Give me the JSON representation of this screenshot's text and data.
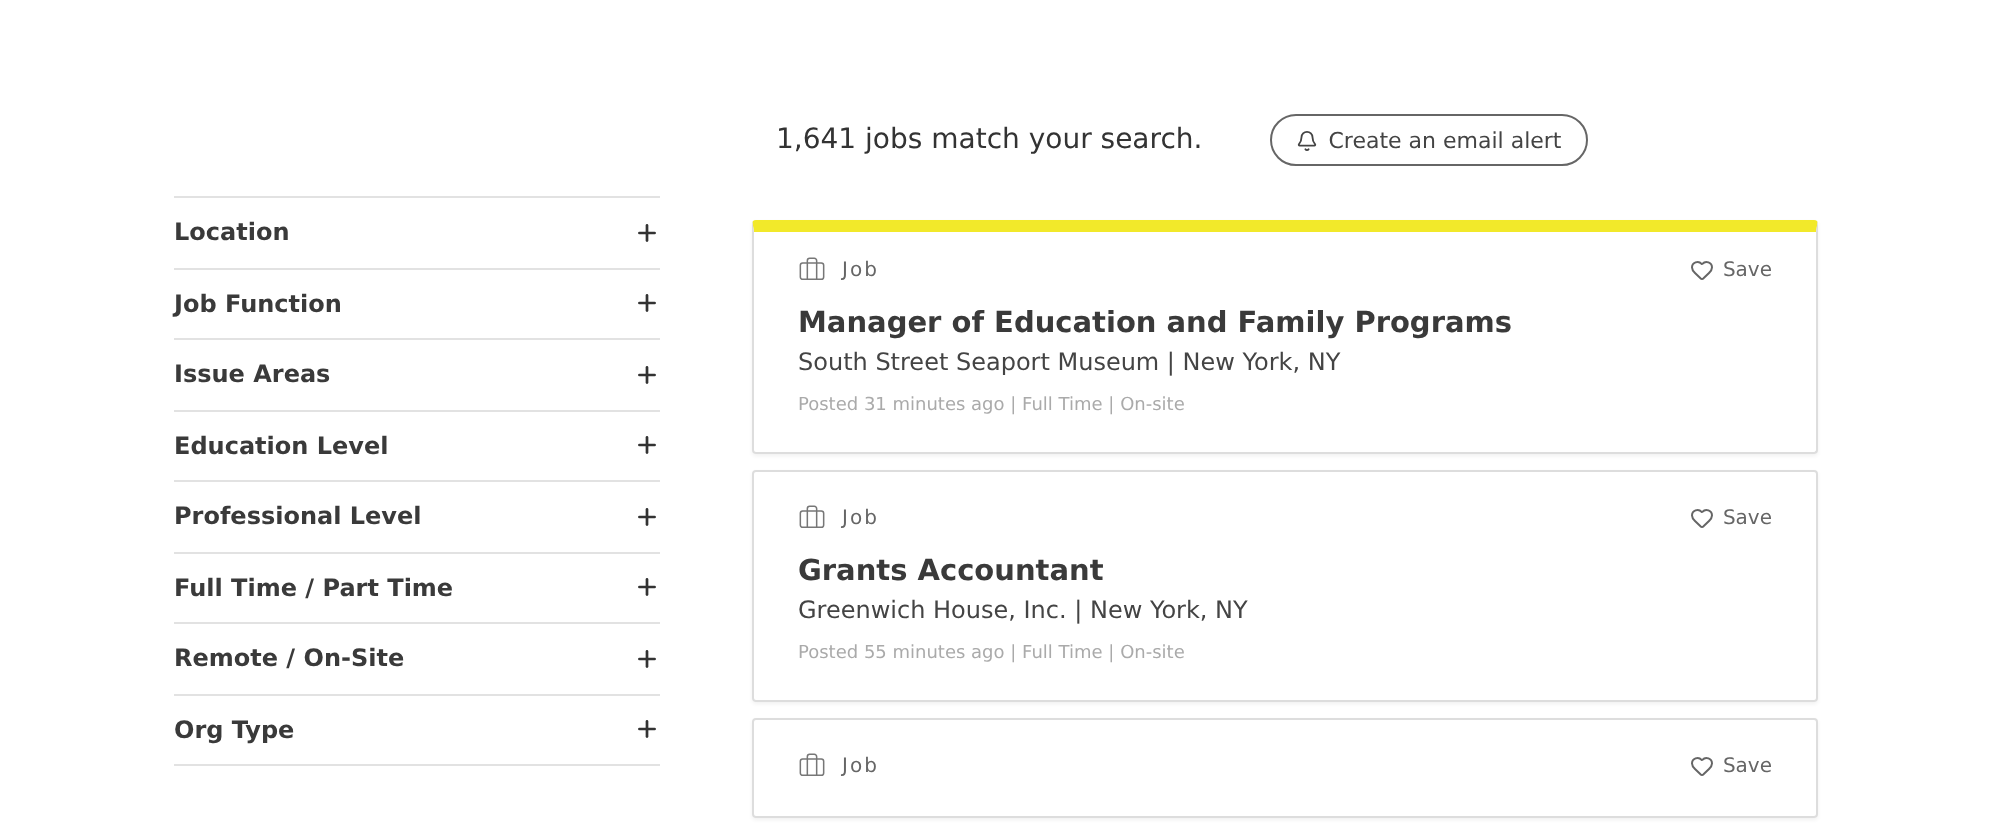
{
  "results": {
    "count_text": "1,641 jobs match your search.",
    "alert_button": "Create an email alert"
  },
  "filters": [
    {
      "label": "Location",
      "expanded": false
    },
    {
      "label": "Job Function",
      "expanded": false
    },
    {
      "label": "Issue Areas",
      "expanded": false
    },
    {
      "label": "Education Level",
      "expanded": false
    },
    {
      "label": "Professional Level",
      "expanded": false
    },
    {
      "label": "Full Time / Part Time",
      "expanded": false
    },
    {
      "label": "Remote / On-Site",
      "expanded": false
    },
    {
      "label": "Org Type",
      "expanded": false
    }
  ],
  "jobs": [
    {
      "type": "Job",
      "save": "Save",
      "highlighted": true,
      "title": "Manager of Education and Family Programs",
      "org": "South Street Seaport Museum | New York, NY",
      "meta": "Posted 31 minutes ago | Full Time | On-site"
    },
    {
      "type": "Job",
      "save": "Save",
      "highlighted": false,
      "title": "Grants Accountant",
      "org": "Greenwich House, Inc. | New York, NY",
      "meta": "Posted 55 minutes ago | Full Time | On-site"
    },
    {
      "type": "Job",
      "save": "Save",
      "highlighted": false
    }
  ]
}
